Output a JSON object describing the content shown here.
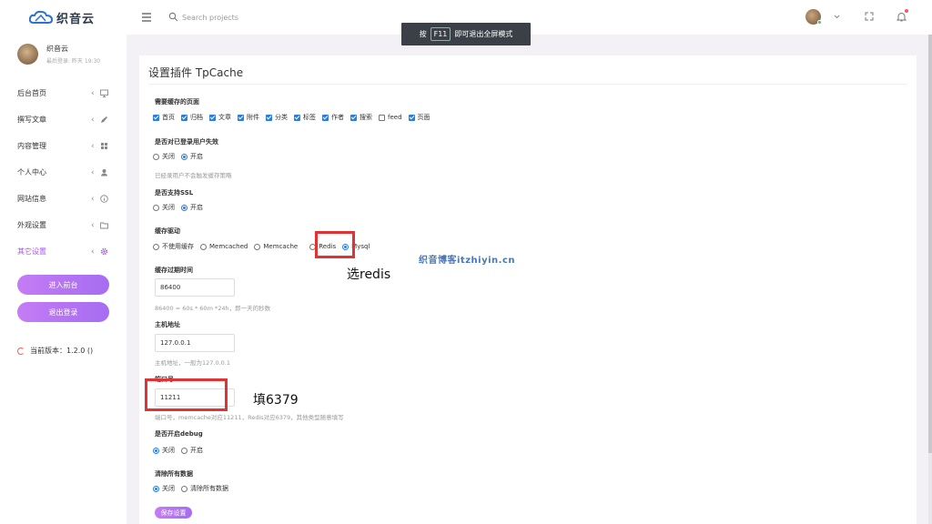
{
  "brand": {
    "name": "织音云"
  },
  "header": {
    "search_placeholder": "Search projects"
  },
  "toast": {
    "before": "按",
    "key": "F11",
    "after": "即可退出全屏模式"
  },
  "profile": {
    "name": "织音云",
    "last_login": "最后登录: 昨天 19:30"
  },
  "sidebar": {
    "items": [
      {
        "label": "后台首页",
        "icon": "monitor-icon"
      },
      {
        "label": "撰写文章",
        "icon": "pencil-icon"
      },
      {
        "label": "内容管理",
        "icon": "layers-icon"
      },
      {
        "label": "个人中心",
        "icon": "user-icon"
      },
      {
        "label": "网站信息",
        "icon": "info-icon"
      },
      {
        "label": "外观设置",
        "icon": "folder-icon"
      },
      {
        "label": "其它设置",
        "icon": "gear-icon"
      }
    ],
    "active_index": 6,
    "enter_label": "进入前台",
    "logout_label": "退出登录",
    "version": "当前版本：1.2.0 ()"
  },
  "page": {
    "title": "设置插件 TpCache"
  },
  "form": {
    "pages": {
      "label": "需要缓存的页面",
      "options": [
        {
          "label": "首页",
          "checked": true
        },
        {
          "label": "归档",
          "checked": true
        },
        {
          "label": "文章",
          "checked": true
        },
        {
          "label": "附件",
          "checked": true
        },
        {
          "label": "分类",
          "checked": true
        },
        {
          "label": "标签",
          "checked": true
        },
        {
          "label": "作者",
          "checked": true
        },
        {
          "label": "搜索",
          "checked": true
        },
        {
          "label": "feed",
          "checked": false
        },
        {
          "label": "页面",
          "checked": true
        }
      ]
    },
    "login_invalid": {
      "label": "是否对已登录用户失效",
      "off": "关闭",
      "on": "开启",
      "hint": "已经录用户不会触发缓存策略"
    },
    "ssl": {
      "label": "是否支持SSL",
      "off": "关闭",
      "on": "开启"
    },
    "driver": {
      "label": "缓存驱动",
      "options": [
        "不使用缓存",
        "Memcached",
        "Memcache",
        "Redis",
        "Mysql"
      ],
      "selected": "Mysql"
    },
    "expire": {
      "label": "缓存过期时间",
      "value": "86400",
      "hint": "86400 = 60s * 60m *24h，即一天的秒数"
    },
    "host": {
      "label": "主机地址",
      "value": "127.0.0.1",
      "hint": "主机地址，一般为127.0.0.1"
    },
    "port": {
      "label": "端口号",
      "value": "11211",
      "hint": "端口号，memcache对应11211，Redis对应6379，其他类型随意填写"
    },
    "debug": {
      "label": "是否开启debug",
      "off": "关闭",
      "on": "开启"
    },
    "clear": {
      "label": "清除所有数据",
      "off": "关闭",
      "on": "清除所有数据"
    },
    "save_label": "保存设置"
  },
  "annotations": {
    "redis_note": "选redis",
    "port_note": "填6379",
    "watermark": "织音博客itzhiyin.cn"
  },
  "colors": {
    "accent": "#a855f7",
    "checkbox": "#2a7de1",
    "highlight": "#e03333"
  }
}
